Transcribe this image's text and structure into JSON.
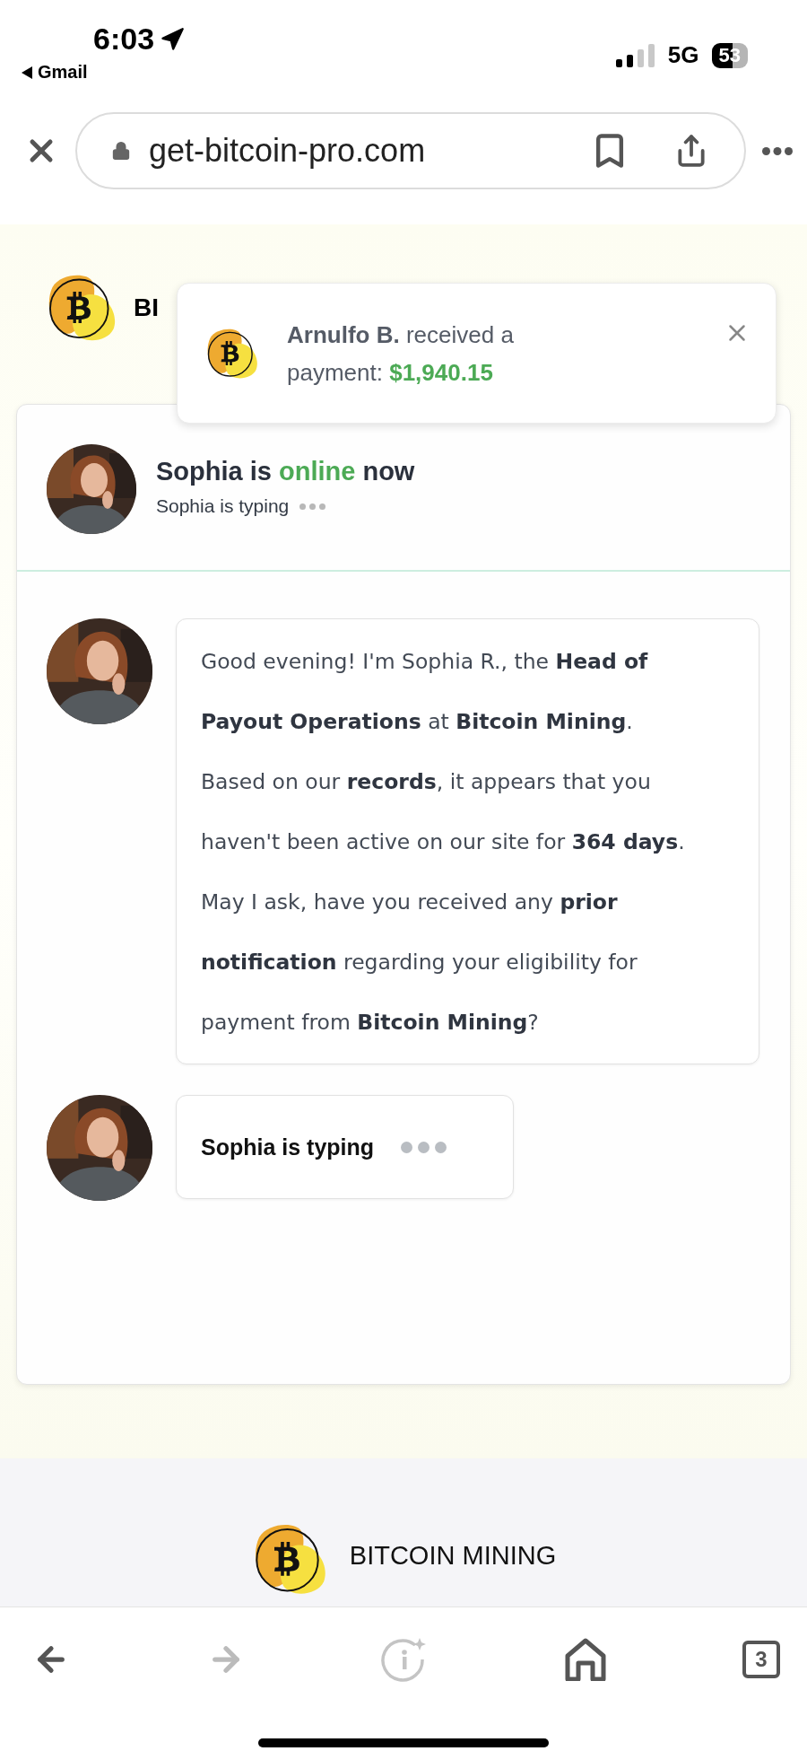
{
  "status_bar": {
    "time": "6:03",
    "back_app": "Gmail",
    "network": "5G",
    "battery": "53"
  },
  "browser": {
    "url": "get-bitcoin-pro.com"
  },
  "site_header": {
    "brand": "BI"
  },
  "notification": {
    "name": "Arnulfo B.",
    "message": "received a payment:",
    "amount": "$1,940.15"
  },
  "chat_header": {
    "name": "Sophia is",
    "status": "online",
    "status_end": "now",
    "subtitle": "Sophia is typing"
  },
  "messages": [
    {
      "kind": "text",
      "paragraphs": [
        "Good evening! I'm Sophia R., the **Head of Payout Operations** at **Bitcoin Mining**.",
        "Based on our **records**, it appears that you haven't been active on our site for **364 days**.",
        "May I ask, have you received any **prior notification** regarding your eligibility for payment from **Bitcoin Mining**?"
      ]
    },
    {
      "kind": "typing",
      "text": "Sophia is typing"
    }
  ],
  "footer": {
    "brand": "BITCOIN MINING"
  },
  "toolbar": {
    "forward_disabled": true,
    "tab_count": "3"
  }
}
